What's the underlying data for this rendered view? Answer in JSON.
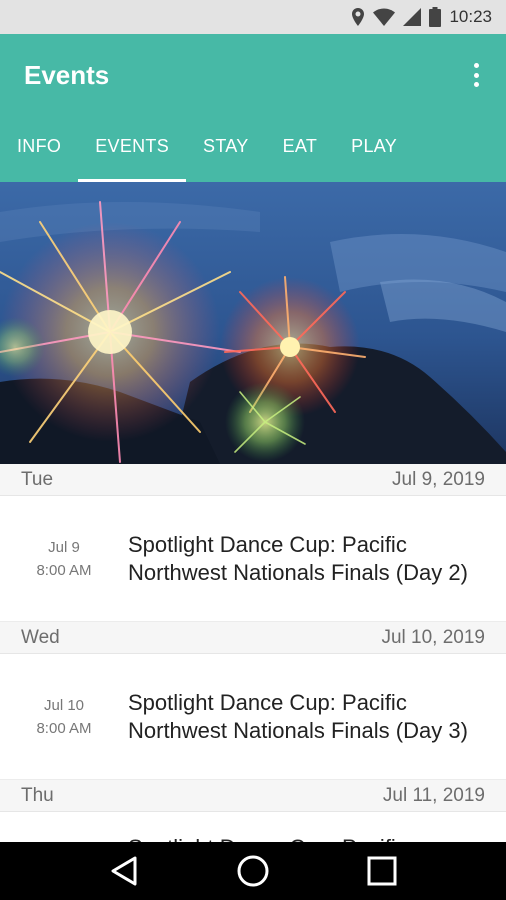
{
  "status": {
    "time": "10:23"
  },
  "appbar": {
    "title": "Events"
  },
  "tabs": [
    {
      "label": "INFO"
    },
    {
      "label": "EVENTS"
    },
    {
      "label": "STAY"
    },
    {
      "label": "EAT"
    },
    {
      "label": "PLAY"
    }
  ],
  "days": [
    {
      "weekday": "Tue",
      "date": "Jul 9, 2019",
      "event": {
        "date": "Jul 9",
        "time": "8:00 AM",
        "title": "Spotlight Dance Cup: Pacific Northwest Nationals Finals (Day 2)"
      }
    },
    {
      "weekday": "Wed",
      "date": "Jul 10, 2019",
      "event": {
        "date": "Jul 10",
        "time": "8:00 AM",
        "title": "Spotlight Dance Cup: Pacific Northwest Nationals Finals (Day 3)"
      }
    },
    {
      "weekday": "Thu",
      "date": "Jul 11, 2019",
      "event": {
        "date": "",
        "time": "",
        "title": "Spotlight Dance Cup: Pacific"
      }
    }
  ],
  "colors": {
    "accent": "#47b9a6"
  }
}
